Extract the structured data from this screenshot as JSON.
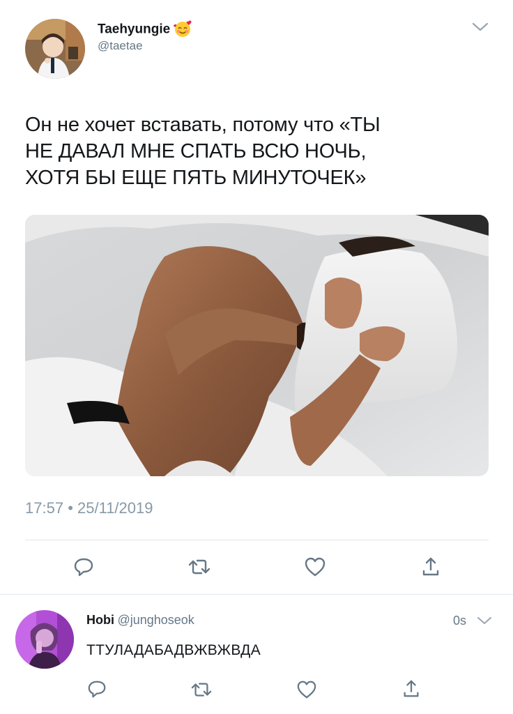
{
  "tweet": {
    "author_name": "Taehyungie",
    "author_emoji": "smiling-face-with-hearts-emoji",
    "author_handle": "@taetae",
    "text_lines": [
      "Он не хочет вставать, потому что «ТЫ",
      "НЕ ДАВАЛ МНЕ СПАТЬ ВСЮ НОЧЬ,",
      "ХОТЯ БЫ ЕЩЕ ПЯТЬ МИНУТОЧЕК»"
    ],
    "time": "17:57",
    "separator": "•",
    "date": "25/11/2019",
    "actions": [
      "reply-icon",
      "retweet-icon",
      "like-icon",
      "share-icon"
    ]
  },
  "reply": {
    "author_name": "Hobi",
    "author_handle": "@junghoseok",
    "age": "0s",
    "text": "ТТУЛАДАБАДВЖВЖВДА",
    "actions": [
      "reply-icon",
      "retweet-icon",
      "like-icon",
      "share-icon"
    ]
  },
  "colors": {
    "text": "#14171a",
    "secondary": "#657786",
    "icon": "#657786",
    "divider": "#e1e8ed",
    "reply_avatar": "#b24fd6"
  }
}
